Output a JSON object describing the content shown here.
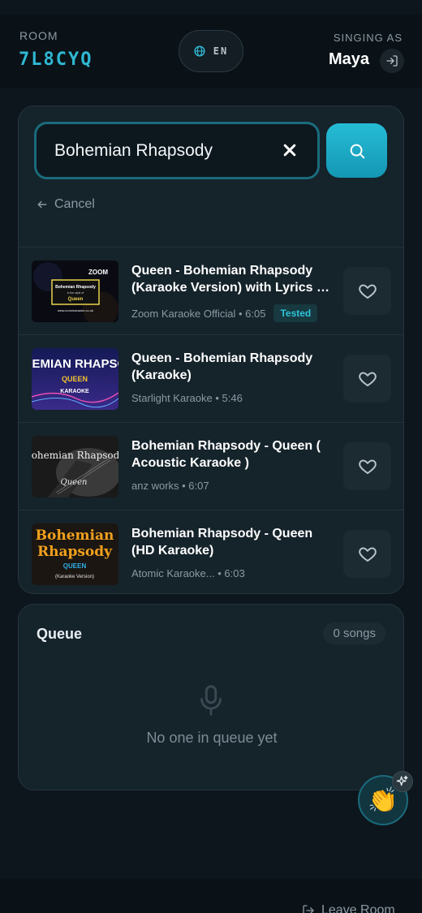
{
  "header": {
    "room_label": "ROOM",
    "room_code": "7L8CYQ",
    "language": "EN",
    "singing_as_label": "SINGING AS",
    "user_name": "Maya"
  },
  "search": {
    "query": "Bohemian Rhapsody",
    "cancel_label": "Cancel"
  },
  "results": [
    {
      "title_line1": "Queen - Bohemian Rhapsody",
      "title_line2": "(Karaoke Version) with Lyrics O...",
      "meta": "Zoom Karaoke Official • 6:05",
      "badge": "Tested",
      "thumb_text": [
        "ZOOM",
        "Bohemian Rhapsody",
        "in the style of",
        "Queen",
        "www.zoomkaraoke.co.uk"
      ]
    },
    {
      "title_line1": "Queen - Bohemian Rhapsody",
      "title_line2": "(Karaoke)",
      "meta": "Starlight Karaoke • 5:46",
      "badge": "",
      "thumb_text": [
        "OHEMIAN RHAPSOD",
        "QUEEN",
        "KARAOKE"
      ]
    },
    {
      "title_line1": "Bohemian Rhapsody - Queen (",
      "title_line2": "Acoustic Karaoke )",
      "meta": "anz works • 6:07",
      "badge": "",
      "thumb_text": [
        "Bohemian Rhapsody",
        "Queen"
      ]
    },
    {
      "title_line1": "Bohemian Rhapsody - Queen",
      "title_line2": "(HD Karaoke)",
      "meta": "Atomic Karaoke... • 6:03",
      "badge": "",
      "thumb_text": [
        "Bohemian",
        "Rhapsody",
        "QUEEN",
        "(Karaoke Version)"
      ]
    }
  ],
  "queue": {
    "title": "Queue",
    "count": "0 songs",
    "empty_text": "No one in queue yet"
  },
  "footer": {
    "leave_label": "Leave Room"
  },
  "colors": {
    "accent": "#26bcd6",
    "room_code": "#2fb8d3",
    "background": "#0d161c",
    "card": "#15232b"
  }
}
